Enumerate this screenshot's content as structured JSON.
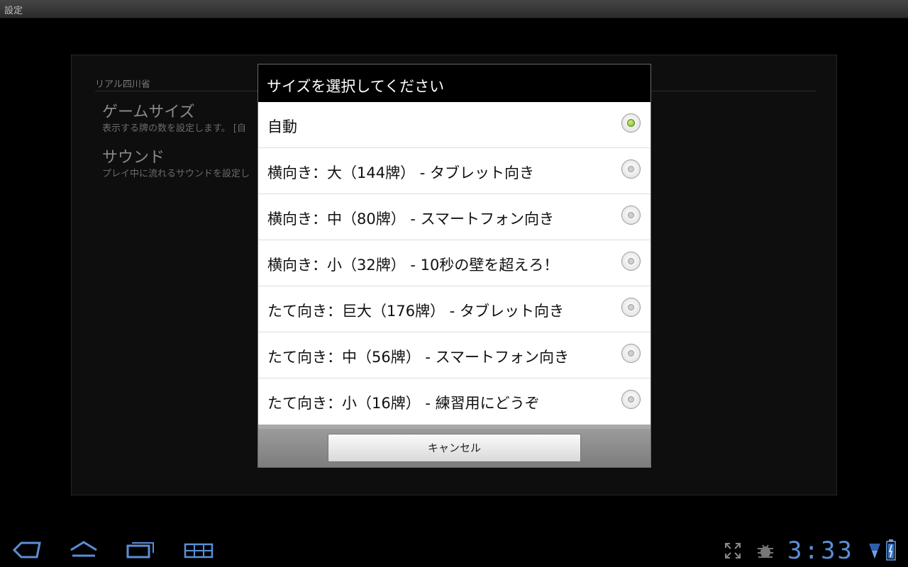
{
  "titlebar": {
    "title": "設定"
  },
  "settings": {
    "category": "リアル四川省",
    "items": [
      {
        "title": "ゲームサイズ",
        "summary": "表示する牌の数を設定します。 [自"
      },
      {
        "title": "サウンド",
        "summary": "プレイ中に流れるサウンドを設定し"
      }
    ]
  },
  "dialog": {
    "title": "サイズを選択してください",
    "options": [
      {
        "label": "自動",
        "selected": true
      },
      {
        "label": "横向き：大（144牌） - タブレット向き",
        "selected": false
      },
      {
        "label": "横向き：中（80牌） - スマートフォン向き",
        "selected": false
      },
      {
        "label": "横向き：小（32牌） - 10秒の壁を超えろ！",
        "selected": false
      },
      {
        "label": "たて向き：巨大（176牌） - タブレット向き",
        "selected": false
      },
      {
        "label": "たて向き：中（56牌） - スマートフォン向き",
        "selected": false
      },
      {
        "label": "たて向き：小（16牌） - 練習用にどうぞ",
        "selected": false
      }
    ],
    "cancel_label": "キャンセル"
  },
  "systembar": {
    "clock": "3:33",
    "icons": [
      "back-icon",
      "home-icon",
      "recent-apps-icon",
      "menu-icon",
      "fullscreen-icon",
      "debug-icon",
      "wifi-icon",
      "battery-icon"
    ],
    "accent": "#5b8fd6"
  }
}
